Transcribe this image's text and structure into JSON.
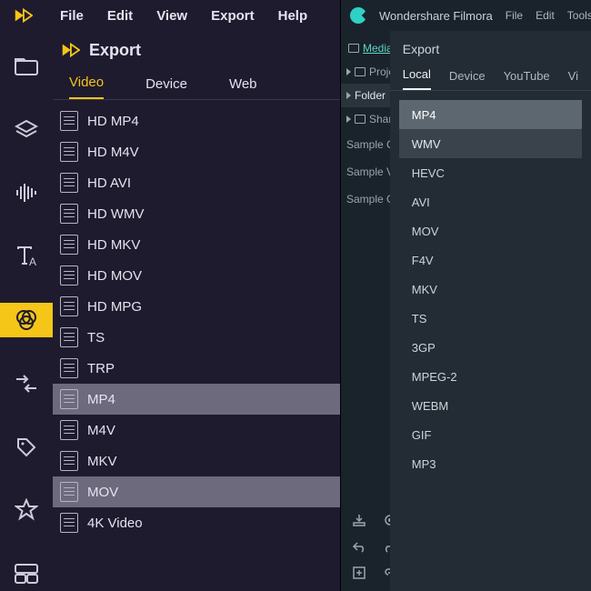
{
  "left": {
    "menubar": [
      "File",
      "Edit",
      "View",
      "Export",
      "Help"
    ],
    "panel_title": "Export",
    "tabs": [
      {
        "label": "Video",
        "active": true
      },
      {
        "label": "Device",
        "active": false
      },
      {
        "label": "Web",
        "active": false
      }
    ],
    "formats": [
      {
        "label": "HD MP4",
        "selected": false
      },
      {
        "label": "HD M4V",
        "selected": false
      },
      {
        "label": "HD AVI",
        "selected": false
      },
      {
        "label": "HD WMV",
        "selected": false
      },
      {
        "label": "HD MKV",
        "selected": false
      },
      {
        "label": "HD MOV",
        "selected": false
      },
      {
        "label": "HD MPG",
        "selected": false
      },
      {
        "label": "TS",
        "selected": false
      },
      {
        "label": "TRP",
        "selected": false
      },
      {
        "label": "MP4",
        "selected": true
      },
      {
        "label": "M4V",
        "selected": false
      },
      {
        "label": "MKV",
        "selected": false
      },
      {
        "label": "MOV",
        "selected": true
      },
      {
        "label": "4K Video",
        "selected": false
      }
    ],
    "rail_active_index": 4
  },
  "right": {
    "app_name": "Wondershare Filmora",
    "menubar": [
      "File",
      "Edit",
      "Tools"
    ],
    "sidebar": {
      "header": "Media",
      "tree": [
        {
          "label": "Proje",
          "hasFolder": true,
          "selected": false
        },
        {
          "label": "Folder",
          "hasFolder": false,
          "selected": true
        },
        {
          "label": "Share",
          "hasFolder": true,
          "selected": false
        }
      ],
      "samples": [
        "Sample Colo",
        "Sample Vide",
        "Sample Gre"
      ]
    },
    "export": {
      "title": "Export",
      "tabs": [
        {
          "label": "Local",
          "active": true
        },
        {
          "label": "Device",
          "active": false
        },
        {
          "label": "YouTube",
          "active": false
        },
        {
          "label": "Vi",
          "active": false
        }
      ],
      "formats": [
        {
          "label": "MP4",
          "sel": 1
        },
        {
          "label": "WMV",
          "sel": 2
        },
        {
          "label": "HEVC",
          "sel": 0
        },
        {
          "label": "AVI",
          "sel": 0
        },
        {
          "label": "MOV",
          "sel": 0
        },
        {
          "label": "F4V",
          "sel": 0
        },
        {
          "label": "MKV",
          "sel": 0
        },
        {
          "label": "TS",
          "sel": 0
        },
        {
          "label": "3GP",
          "sel": 0
        },
        {
          "label": "MPEG-2",
          "sel": 0
        },
        {
          "label": "WEBM",
          "sel": 0
        },
        {
          "label": "GIF",
          "sel": 0
        },
        {
          "label": "MP3",
          "sel": 0
        }
      ]
    }
  }
}
